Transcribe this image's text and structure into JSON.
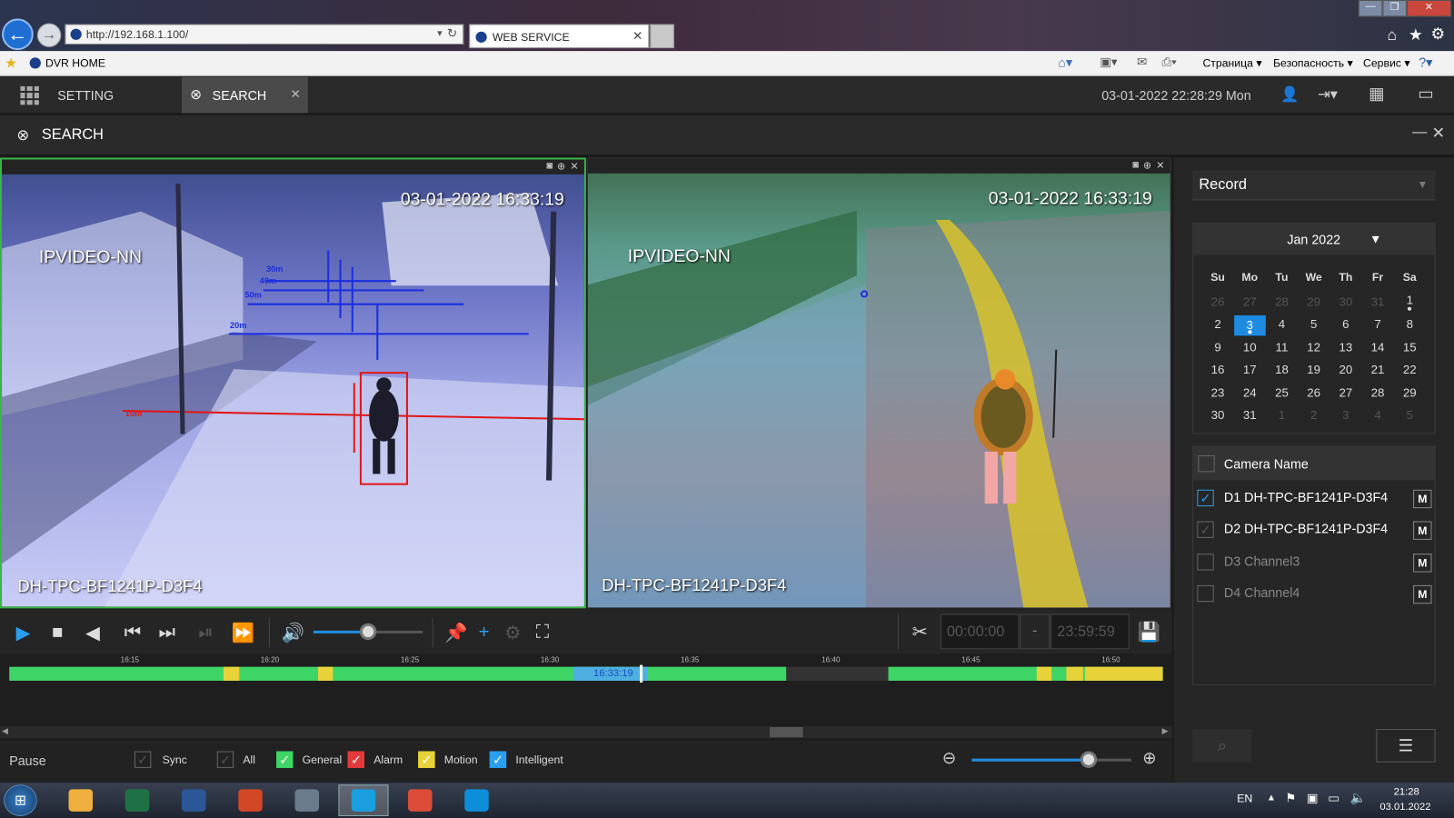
{
  "browser": {
    "url": "http://192.168.1.100/",
    "tab_title": "WEB SERVICE",
    "favorite": "DVR HOME",
    "menu": [
      "Страница ▾",
      "Безопасность ▾",
      "Сервис ▾"
    ]
  },
  "app": {
    "tabs": [
      {
        "label": "SETTING"
      },
      {
        "label": "SEARCH"
      }
    ],
    "datetime": "03-01-2022 22:28:29 Mon",
    "page_title": "SEARCH"
  },
  "videos": [
    {
      "timestamp": "03-01-2022 16:33:19",
      "label": "IPVIDEO-NN",
      "camera": "DH-TPC-BF1241P-D3F4"
    },
    {
      "timestamp": "03-01-2022 16:33:19",
      "label": "IPVIDEO-NN",
      "camera": "DH-TPC-BF1241P-D3F4"
    }
  ],
  "overlay": {
    "distances": [
      "30m",
      "40m",
      "50m",
      "20m",
      "10m"
    ]
  },
  "playback": {
    "volume_level": 0.5,
    "time_start": "00:00:00",
    "time_sep": "-",
    "time_end": "23:59:59"
  },
  "timeline": {
    "ticks": [
      "16:15",
      "16:20",
      "16:25",
      "16:30",
      "16:35",
      "16:40",
      "16:45",
      "16:50"
    ],
    "cursor": "16:33:19"
  },
  "status": {
    "state": "Pause",
    "filters": [
      {
        "label": "Sync",
        "checked": false
      },
      {
        "label": "All",
        "checked": false
      },
      {
        "label": "General",
        "checked": true
      },
      {
        "label": "Alarm",
        "checked": true
      },
      {
        "label": "Motion",
        "checked": true
      },
      {
        "label": "Intelligent",
        "checked": true
      }
    ],
    "zoom_level": 0.73
  },
  "right": {
    "record_type": "Record",
    "calendar": {
      "month": "Jan 2022",
      "weekdays": [
        "Su",
        "Mo",
        "Tu",
        "We",
        "Th",
        "Fr",
        "Sa"
      ],
      "weeks": [
        [
          "26",
          "27",
          "28",
          "29",
          "30",
          "31",
          "1"
        ],
        [
          "2",
          "3",
          "4",
          "5",
          "6",
          "7",
          "8"
        ],
        [
          "9",
          "10",
          "11",
          "12",
          "13",
          "14",
          "15"
        ],
        [
          "16",
          "17",
          "18",
          "19",
          "20",
          "21",
          "22"
        ],
        [
          "23",
          "24",
          "25",
          "26",
          "27",
          "28",
          "29"
        ],
        [
          "30",
          "31",
          "1",
          "2",
          "3",
          "4",
          "5"
        ]
      ],
      "selected": "3"
    },
    "camera_header": "Camera Name",
    "cameras": [
      {
        "name": "D1 DH-TPC-BF1241P-D3F4",
        "checked": true
      },
      {
        "name": "D2 DH-TPC-BF1241P-D3F4",
        "checked": true
      },
      {
        "name": "D3 Channel3",
        "checked": false
      },
      {
        "name": "D4 Channel4",
        "checked": false
      }
    ],
    "m_label": "M"
  },
  "taskbar": {
    "lang": "EN",
    "time": "21:28",
    "date": "03.01.2022",
    "apps": [
      {
        "name": "explorer-icon",
        "color": "#f0b040"
      },
      {
        "name": "excel-icon",
        "color": "#1e7145"
      },
      {
        "name": "word-icon",
        "color": "#2b5797"
      },
      {
        "name": "powerpoint-icon",
        "color": "#d24726"
      },
      {
        "name": "calculator-icon",
        "color": "#6a7b8c"
      },
      {
        "name": "ie-icon",
        "color": "#1a9fe0"
      },
      {
        "name": "chrome-icon",
        "color": "#dd4b39"
      },
      {
        "name": "edge-icon",
        "color": "#0c8fd8"
      }
    ]
  }
}
